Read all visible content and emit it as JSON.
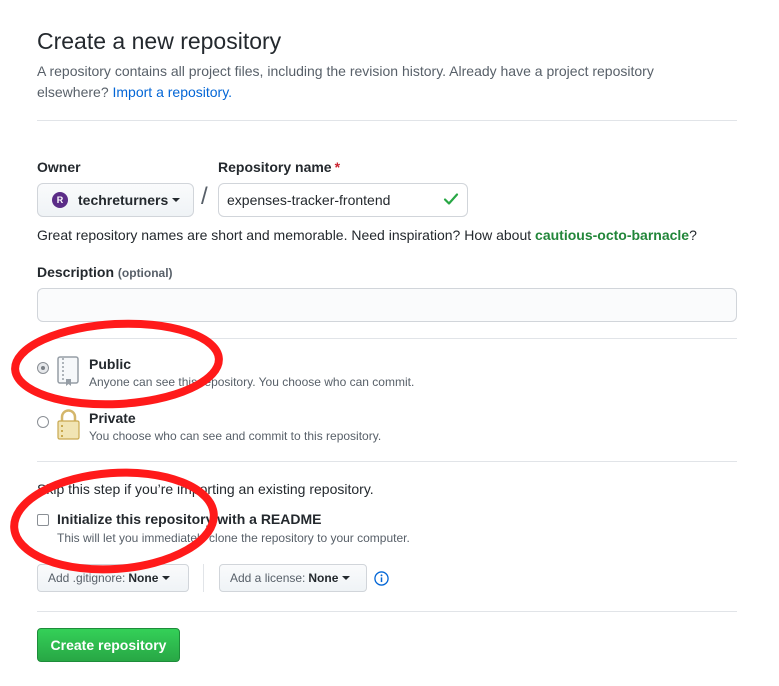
{
  "header": {
    "title": "Create a new repository",
    "subtitle_text": "A repository contains all project files, including the revision history. Already have a project repository elsewhere?",
    "import_link": "Import a repository."
  },
  "owner": {
    "label": "Owner",
    "avatar_letter": "R",
    "value": "techreturners"
  },
  "repo_name": {
    "label": "Repository name",
    "required_mark": "*",
    "separator": "/",
    "value": "expenses-tracker-frontend"
  },
  "hint": {
    "text": "Great repository names are short and memorable. Need inspiration? How about",
    "suggestion": "cautious-octo-barnacle",
    "end": "?"
  },
  "description": {
    "label": "Description",
    "optional": "(optional)",
    "value": ""
  },
  "visibility": {
    "public": {
      "title": "Public",
      "desc": "Anyone can see this repository. You choose who can commit.",
      "selected": true
    },
    "private": {
      "title": "Private",
      "desc": "You choose who can see and commit to this repository.",
      "selected": false
    }
  },
  "init": {
    "skip_text": "Skip this step if you’re importing an existing repository.",
    "readme_label": "Initialize this repository with a README",
    "readme_desc": "This will let you immediately clone the repository to your computer.",
    "readme_checked": false
  },
  "gitignore": {
    "label": "Add .gitignore:",
    "value": "None"
  },
  "license": {
    "label": "Add a license:",
    "value": "None"
  },
  "submit": {
    "label": "Create repository"
  },
  "colors": {
    "accent_green": "#28a745",
    "link_blue": "#0366d6",
    "annotation_red": "#ff1a1a"
  }
}
